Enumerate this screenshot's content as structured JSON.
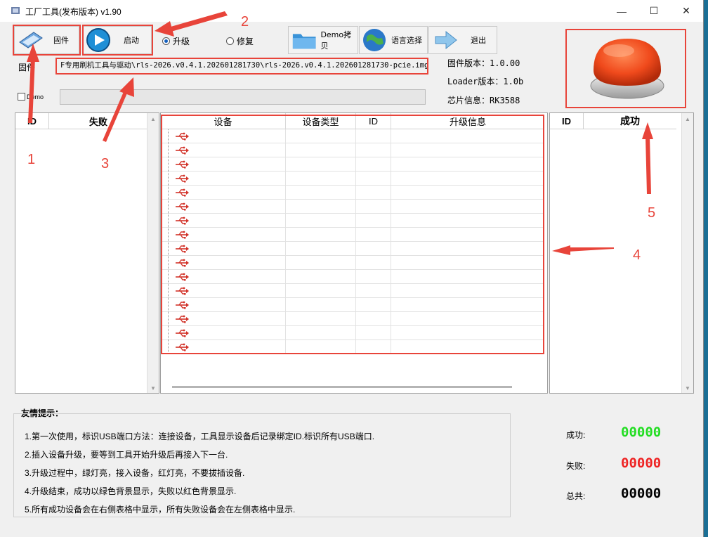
{
  "window": {
    "title": "工厂工具(发布版本) v1.90",
    "minimize": "—",
    "maximize": "☐",
    "close": "✕"
  },
  "toolbar": {
    "firmware_label": "固件",
    "start_label": "启动",
    "upgrade_label": "升级",
    "repair_label": "修复",
    "demo_copy_label": "Demo拷贝",
    "language_label": "语言选择",
    "exit_label": "退出"
  },
  "firmware": {
    "label": "固件",
    "path": "F专用刷机工具与驱动\\rls-2026.v0.4.1.202601281730\\rls-2026.v0.4.1.202601281730-pcie.img"
  },
  "demo": {
    "label": "Demo"
  },
  "device_info": {
    "firmware_version": "固件版本：1.0.00",
    "loader_version": "Loader版本：1.0b",
    "chip_info": "芯片信息：RK3588"
  },
  "fail_table": {
    "col_id": "ID",
    "col_name": "失败"
  },
  "device_table": {
    "col_device": "设备",
    "col_type": "设备类型",
    "col_id": "ID",
    "col_info": "升级信息",
    "row_count": 16,
    "row_icon": "usb-icon"
  },
  "success_table": {
    "col_id": "ID",
    "col_name": "成功"
  },
  "tips": {
    "title": "友情提示：",
    "lines": [
      "1.第一次使用，标识USB端口方法：连接设备，工具显示设备后记录绑定ID.标识所有USB端口.",
      "2.插入设备升级，要等到工具开始升级后再接入下一台.",
      "3.升级过程中，绿灯亮，接入设备，红灯亮，不要拔插设备.",
      "4.升级结束，成功以绿色背景显示，失败以红色背景显示.",
      "5.所有成功设备会在右侧表格中显示，所有失败设备会在左侧表格中显示."
    ]
  },
  "stats": {
    "success_label": "成功:",
    "success_value": "00000",
    "success_color": "#22dd22",
    "fail_label": "失败:",
    "fail_value": "00000",
    "fail_color": "#ee2222",
    "total_label": "总共:",
    "total_value": "00000",
    "total_color": "#000000"
  },
  "annotations": {
    "a1": "1",
    "a2": "2",
    "a3": "3",
    "a4": "4",
    "a5": "5",
    "color": "#e8443a"
  }
}
